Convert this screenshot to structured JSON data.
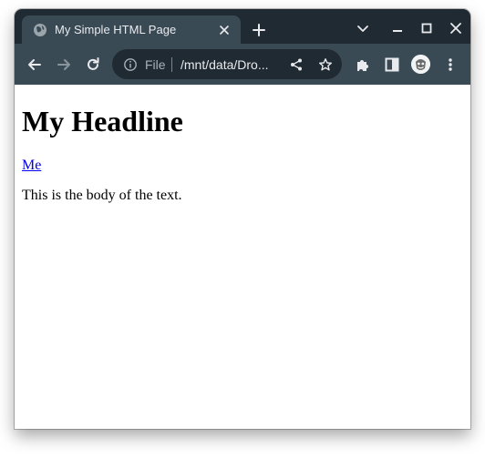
{
  "browser": {
    "tab": {
      "title": "My Simple HTML Page",
      "favicon": "globe-icon"
    },
    "window_controls": [
      "chevron-down-icon",
      "minimize-icon",
      "maximize-icon",
      "close-icon"
    ],
    "toolbar": {
      "buttons": [
        "back-arrow-icon",
        "forward-arrow-icon",
        "reload-icon"
      ],
      "omnibox": {
        "scheme_label": "File",
        "url": "/mnt/data/Dro...",
        "icons": [
          "info-icon",
          "share-icon",
          "star-icon"
        ]
      },
      "extras": [
        "puzzle-icon",
        "side-panel-icon",
        "avatar",
        "kebab-menu-icon"
      ]
    },
    "colors": {
      "tabstrip": "#202a32",
      "toolbar": "#3a4a55",
      "omnibox": "#202a32"
    }
  },
  "page": {
    "headline": "My Headline",
    "link": "Me",
    "body_text": "This is the body of the text."
  }
}
